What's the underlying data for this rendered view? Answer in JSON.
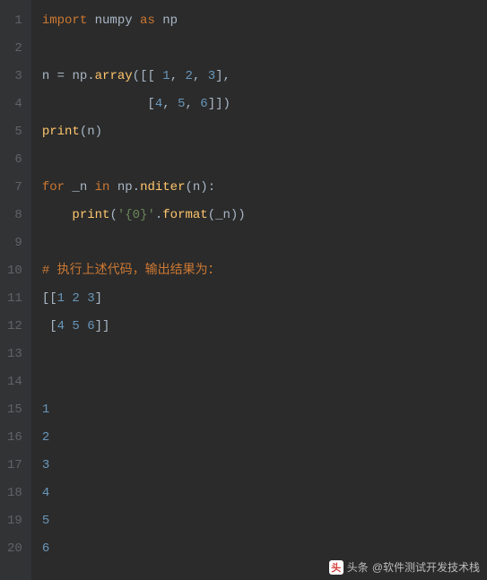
{
  "editor": {
    "line_numbers": [
      "1",
      "2",
      "3",
      "4",
      "5",
      "6",
      "7",
      "8",
      "9",
      "10",
      "11",
      "12",
      "13",
      "14",
      "15",
      "16",
      "17",
      "18",
      "19",
      "20"
    ],
    "lines": [
      [
        {
          "t": "import ",
          "c": "kw"
        },
        {
          "t": "numpy ",
          "c": "id"
        },
        {
          "t": "as ",
          "c": "kw"
        },
        {
          "t": "np",
          "c": "id"
        }
      ],
      [],
      [
        {
          "t": "n ",
          "c": "id"
        },
        {
          "t": "= ",
          "c": "pun"
        },
        {
          "t": "np",
          "c": "id"
        },
        {
          "t": ".",
          "c": "pun"
        },
        {
          "t": "array",
          "c": "fn"
        },
        {
          "t": "([[ ",
          "c": "pun"
        },
        {
          "t": "1",
          "c": "num"
        },
        {
          "t": ", ",
          "c": "pun"
        },
        {
          "t": "2",
          "c": "num"
        },
        {
          "t": ", ",
          "c": "pun"
        },
        {
          "t": "3",
          "c": "num"
        },
        {
          "t": "],",
          "c": "pun"
        }
      ],
      [
        {
          "t": "              [",
          "c": "pun"
        },
        {
          "t": "4",
          "c": "num"
        },
        {
          "t": ", ",
          "c": "pun"
        },
        {
          "t": "5",
          "c": "num"
        },
        {
          "t": ", ",
          "c": "pun"
        },
        {
          "t": "6",
          "c": "num"
        },
        {
          "t": "]])",
          "c": "pun"
        }
      ],
      [
        {
          "t": "print",
          "c": "fn"
        },
        {
          "t": "(n)",
          "c": "pun"
        }
      ],
      [],
      [
        {
          "t": "for ",
          "c": "kw"
        },
        {
          "t": "_n ",
          "c": "id"
        },
        {
          "t": "in ",
          "c": "kw"
        },
        {
          "t": "np",
          "c": "id"
        },
        {
          "t": ".",
          "c": "pun"
        },
        {
          "t": "nditer",
          "c": "fn"
        },
        {
          "t": "(n):",
          "c": "pun"
        }
      ],
      [
        {
          "t": "    ",
          "c": "pun"
        },
        {
          "t": "print",
          "c": "fn"
        },
        {
          "t": "(",
          "c": "pun"
        },
        {
          "t": "'{0}'",
          "c": "str"
        },
        {
          "t": ".",
          "c": "pun"
        },
        {
          "t": "format",
          "c": "fn"
        },
        {
          "t": "(_n))",
          "c": "pun"
        }
      ],
      [],
      [
        {
          "t": "# 执行上述代码，输出结果为：",
          "c": "cmt"
        }
      ],
      [
        {
          "t": "[[",
          "c": "pun"
        },
        {
          "t": "1 2 3",
          "c": "num"
        },
        {
          "t": "]",
          "c": "pun"
        }
      ],
      [
        {
          "t": " [",
          "c": "pun"
        },
        {
          "t": "4 5 6",
          "c": "num"
        },
        {
          "t": "]]",
          "c": "pun"
        }
      ],
      [],
      [],
      [
        {
          "t": "1",
          "c": "num"
        }
      ],
      [
        {
          "t": "2",
          "c": "num"
        }
      ],
      [
        {
          "t": "3",
          "c": "num"
        }
      ],
      [
        {
          "t": "4",
          "c": "num"
        }
      ],
      [
        {
          "t": "5",
          "c": "num"
        }
      ],
      [
        {
          "t": "6",
          "c": "num"
        }
      ]
    ]
  },
  "watermark": {
    "prefix": "头条",
    "handle": "@软件测试开发技术栈"
  }
}
